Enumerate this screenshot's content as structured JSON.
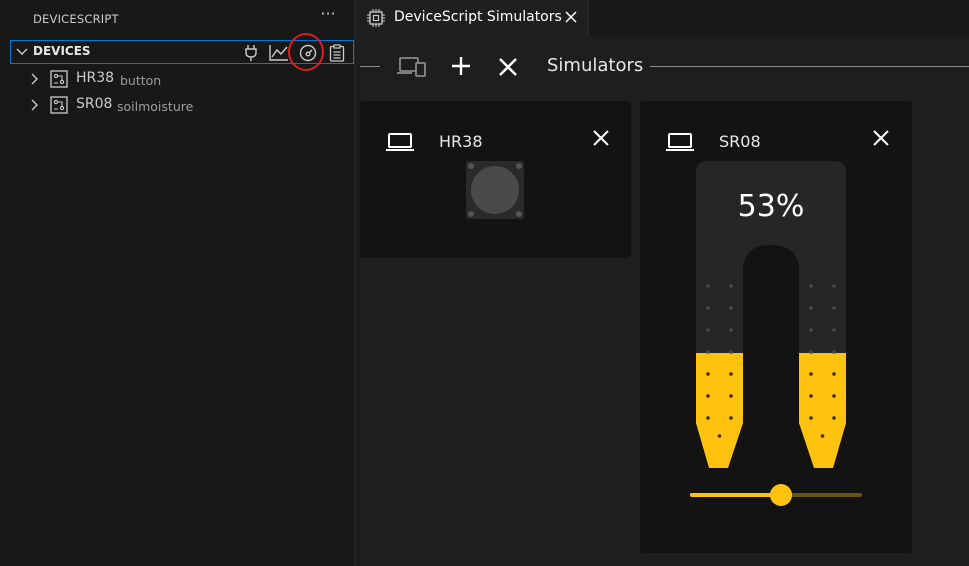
{
  "sidebar": {
    "title": "DEVICESCRIPT",
    "more_icon": "ellipsis-icon",
    "section": {
      "label": "DEVICES",
      "actions": [
        "plug-icon",
        "graph-icon",
        "dashboard-icon",
        "clipboard-icon"
      ],
      "highlighted_action": "dashboard-icon"
    },
    "items": [
      {
        "name": "HR38",
        "description": "button"
      },
      {
        "name": "SR08",
        "description": "soilmoisture"
      }
    ]
  },
  "tab": {
    "label": "DeviceScript Simulators",
    "icon": "circuit-board-icon"
  },
  "toolbar": {
    "title": "Simulators"
  },
  "cards": [
    {
      "name": "HR38",
      "type": "button"
    },
    {
      "name": "SR08",
      "type": "soilmoisture",
      "value_label": "53%",
      "moisture_level": 0.53
    }
  ],
  "colors": {
    "accent": "#0078d4",
    "moisture": "#ffc20e",
    "annotation": "#e11d20"
  }
}
